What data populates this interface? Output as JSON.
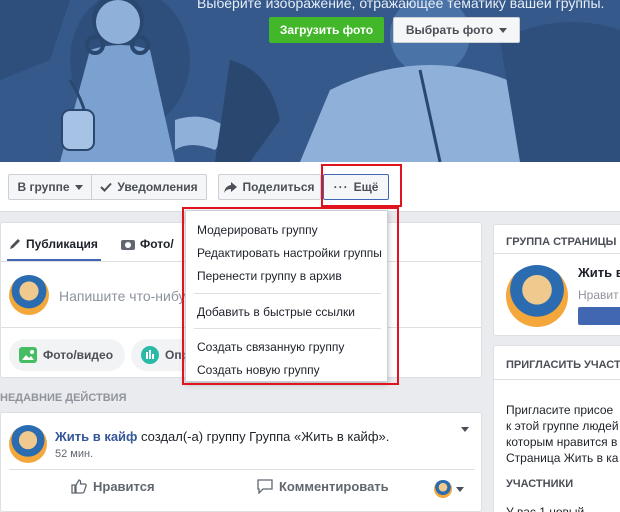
{
  "cover": {
    "hint": "Выберите изображение, отражающее тематику вашей группы.",
    "upload_button": "Загрузить фото",
    "choose_button": "Выбрать фото"
  },
  "actions": {
    "in_group": "В группе",
    "notifications": "Уведомления",
    "share": "Поделиться",
    "more": "Ещё"
  },
  "dropdown": {
    "items": [
      "Модерировать группу",
      "Редактировать настройки группы",
      "Перенести группу в архив",
      "Добавить в быстрые ссылки",
      "Создать связанную группу",
      "Создать новую группу"
    ]
  },
  "composer": {
    "tab_post": "Публикация",
    "tab_photo": "Фото/",
    "placeholder": "Напишите что-нибуд",
    "chip_photo": "Фото/видео",
    "chip_poll": "Опр"
  },
  "recent": {
    "title": "НЕДАВНИЕ ДЕЙСТВИЯ",
    "author": "Жить в кайф",
    "action_text": " создал(-а) группу Группа «Жить в кайф».",
    "time": "52 мин.",
    "like": "Нравится",
    "comment": "Комментировать"
  },
  "right": {
    "page_group_title": "ГРУППА СТРАНИЦЫ",
    "page_name": "Жить в",
    "page_like": "Нравит",
    "invite_title": "ПРИГЛАСИТЬ УЧАСТ",
    "invite_lines": [
      "Пригласите присое",
      "к этой группе людей",
      "которым нравится в",
      "Страница Жить в ка"
    ],
    "members_title": "УЧАСТНИКИ",
    "members_text": "У вас 1 новый"
  },
  "colors": {
    "accent": "#4267b2",
    "green": "#42b72a",
    "highlight": "#e0141e",
    "cover": "#3b5f8f"
  }
}
